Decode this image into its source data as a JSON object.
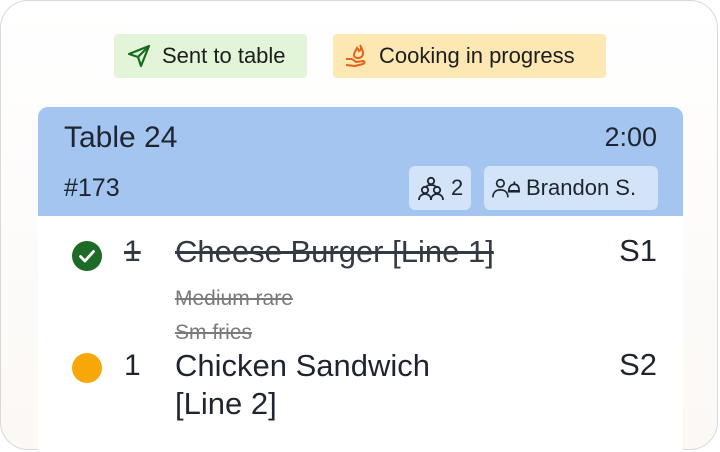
{
  "legend": {
    "sent": {
      "label": "Sent to table",
      "icon": "paper-plane-icon",
      "color": "#e3f5d9"
    },
    "cooking": {
      "label": "Cooking in progress",
      "icon": "flame-hand-icon",
      "color": "#fde8b4"
    }
  },
  "ticket": {
    "table": "Table 24",
    "timer": "2:00",
    "order_number": "#173",
    "guests": "2",
    "server": "Brandon S.",
    "header_color": "#a3c5ef",
    "items": [
      {
        "status": "done",
        "status_color": "#1d6b27",
        "qty": "1",
        "name": "Cheese Burger [Line 1]",
        "seat": "S1",
        "struck": true,
        "modifiers": [
          "Medium rare",
          "Sm fries"
        ]
      },
      {
        "status": "cooking",
        "status_color": "#f7a70a",
        "qty": "1",
        "name_line1": "Chicken Sandwich",
        "name_line2": "[Line 2]",
        "seat": "S2",
        "struck": false,
        "modifiers": []
      }
    ]
  }
}
